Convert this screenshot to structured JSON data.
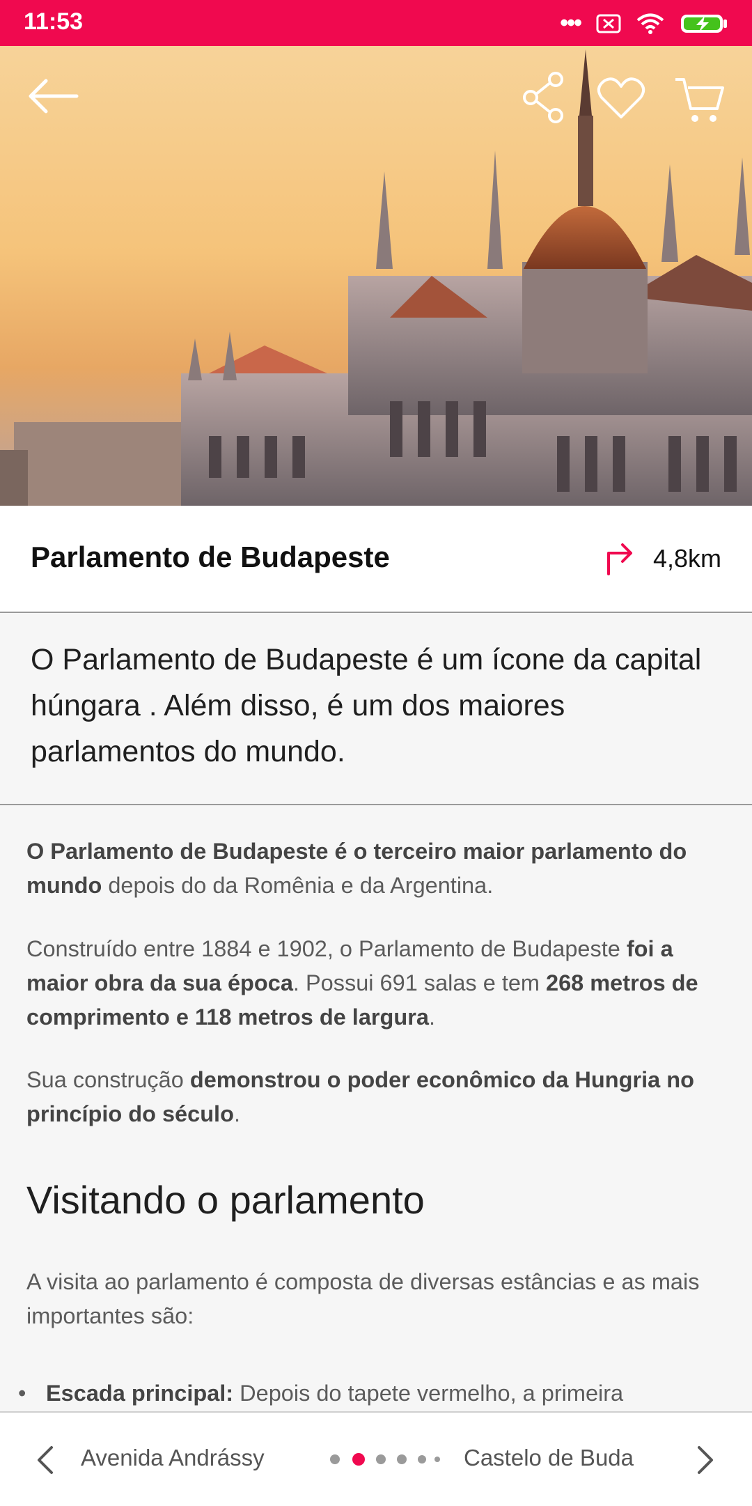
{
  "status_bar": {
    "time": "11:53"
  },
  "place": {
    "name": "Parlamento de Budapeste",
    "distance": "4,8km"
  },
  "lead_text": "O Parlamento de Budapeste é um ícone da capital húngara . Além disso, é um dos maiores parlamentos do mundo.",
  "paragraphs": [
    {
      "bold1": "O Parlamento de Budapeste é o terceiro maior parlamento do mundo",
      "text1": " depois do da Romênia e da Argentina."
    },
    {
      "text1": "Construído entre 1884 e 1902, o Parlamento de Budapeste ",
      "bold1": "foi a maior obra da sua época",
      "text2": ". Possui 691 salas e tem ",
      "bold2": "268 metros de comprimento e 118 metros de largura",
      "text3": "."
    },
    {
      "text1": "Sua construção ",
      "bold1": "demonstrou o poder econômico da Hungria no princípio do século",
      "text2": "."
    }
  ],
  "section_heading": "Visitando o parlamento",
  "section_intro": "A visita ao parlamento é composta de diversas estâncias e as mais importantes são:",
  "bullets": [
    {
      "bold": "Escada principal:",
      "text": " Depois do tapete vermelho, a primeira impressão é surpreendente. No descanso central você pode"
    }
  ],
  "bottom_nav": {
    "prev_label": "Avenida Andrássy",
    "next_label": "Castelo de Buda",
    "page_count": 6,
    "active_page": 2
  },
  "colors": {
    "accent": "#f0094f",
    "status_bar": "#f0094f"
  }
}
